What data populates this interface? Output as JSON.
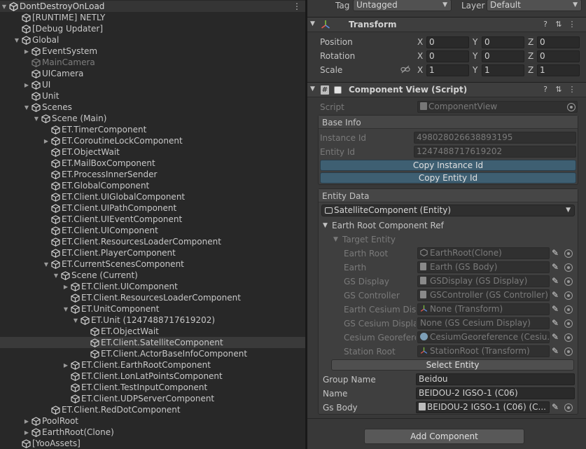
{
  "hierarchy": {
    "root": "DontDestroyOnLoad",
    "rows": [
      {
        "label": "[RUNTIME] NETLY",
        "depth": 1,
        "fold": "none",
        "style": "normal"
      },
      {
        "label": "[Debug Updater]",
        "depth": 1,
        "fold": "none",
        "style": "normal"
      },
      {
        "label": "Global",
        "depth": 1,
        "fold": "open",
        "style": "normal"
      },
      {
        "label": "EventSystem",
        "depth": 2,
        "fold": "closed",
        "style": "normal"
      },
      {
        "label": "MainCamera",
        "depth": 2,
        "fold": "none",
        "style": "dim"
      },
      {
        "label": "UICamera",
        "depth": 2,
        "fold": "none",
        "style": "normal"
      },
      {
        "label": "UI",
        "depth": 2,
        "fold": "closed",
        "style": "normal"
      },
      {
        "label": "Unit",
        "depth": 2,
        "fold": "none",
        "style": "normal"
      },
      {
        "label": "Scenes",
        "depth": 2,
        "fold": "open",
        "style": "normal"
      },
      {
        "label": "Scene (Main)",
        "depth": 3,
        "fold": "open",
        "style": "normal"
      },
      {
        "label": "ET.TimerComponent",
        "depth": 4,
        "fold": "none",
        "style": "normal"
      },
      {
        "label": "ET.CoroutineLockComponent",
        "depth": 4,
        "fold": "closed",
        "style": "normal"
      },
      {
        "label": "ET.ObjectWait",
        "depth": 4,
        "fold": "none",
        "style": "normal"
      },
      {
        "label": "ET.MailBoxComponent",
        "depth": 4,
        "fold": "none",
        "style": "normal"
      },
      {
        "label": "ET.ProcessInnerSender",
        "depth": 4,
        "fold": "none",
        "style": "normal"
      },
      {
        "label": "ET.GlobalComponent",
        "depth": 4,
        "fold": "none",
        "style": "normal"
      },
      {
        "label": "ET.Client.UIGlobalComponent",
        "depth": 4,
        "fold": "none",
        "style": "normal"
      },
      {
        "label": "ET.Client.UIPathComponent",
        "depth": 4,
        "fold": "none",
        "style": "normal"
      },
      {
        "label": "ET.Client.UIEventComponent",
        "depth": 4,
        "fold": "none",
        "style": "normal"
      },
      {
        "label": "ET.Client.UIComponent",
        "depth": 4,
        "fold": "none",
        "style": "normal"
      },
      {
        "label": "ET.Client.ResourcesLoaderComponent",
        "depth": 4,
        "fold": "none",
        "style": "normal"
      },
      {
        "label": "ET.Client.PlayerComponent",
        "depth": 4,
        "fold": "none",
        "style": "normal"
      },
      {
        "label": "ET.CurrentScenesComponent",
        "depth": 4,
        "fold": "open",
        "style": "normal"
      },
      {
        "label": "Scene (Current)",
        "depth": 5,
        "fold": "open",
        "style": "normal"
      },
      {
        "label": "ET.Client.UIComponent",
        "depth": 6,
        "fold": "closed",
        "style": "normal"
      },
      {
        "label": "ET.Client.ResourcesLoaderComponent",
        "depth": 6,
        "fold": "none",
        "style": "normal"
      },
      {
        "label": "ET.UnitComponent",
        "depth": 6,
        "fold": "open",
        "style": "normal"
      },
      {
        "label": "ET.Unit (1247488717619202)",
        "depth": 7,
        "fold": "open",
        "style": "normal"
      },
      {
        "label": "ET.ObjectWait",
        "depth": 8,
        "fold": "none",
        "style": "normal"
      },
      {
        "label": "ET.Client.SatelliteComponent",
        "depth": 8,
        "fold": "none",
        "style": "selected"
      },
      {
        "label": "ET.Client.ActorBaseInfoComponent",
        "depth": 8,
        "fold": "none",
        "style": "normal"
      },
      {
        "label": "ET.Client.EarthRootComponent",
        "depth": 6,
        "fold": "closed",
        "style": "normal"
      },
      {
        "label": "ET.Client.LonLatPointsComponent",
        "depth": 6,
        "fold": "none",
        "style": "normal"
      },
      {
        "label": "ET.Client.TestInputComponent",
        "depth": 6,
        "fold": "none",
        "style": "normal"
      },
      {
        "label": "ET.Client.UDPServerComponent",
        "depth": 6,
        "fold": "none",
        "style": "normal"
      },
      {
        "label": "ET.Client.RedDotComponent",
        "depth": 4,
        "fold": "none",
        "style": "normal"
      },
      {
        "label": "PoolRoot",
        "depth": 2,
        "fold": "closed",
        "style": "normal"
      },
      {
        "label": "EarthRoot(Clone)",
        "depth": 2,
        "fold": "closed",
        "style": "normal"
      },
      {
        "label": "[YooAssets]",
        "depth": 1,
        "fold": "none",
        "style": "normal"
      }
    ]
  },
  "inspector": {
    "tag_label": "Tag",
    "tag_value": "Untagged",
    "layer_label": "Layer",
    "layer_value": "Default",
    "transform": {
      "title": "Transform",
      "position_label": "Position",
      "rotation_label": "Rotation",
      "scale_label": "Scale",
      "axis_x": "X",
      "axis_y": "Y",
      "axis_z": "Z",
      "position": [
        "0",
        "0",
        "0"
      ],
      "rotation": [
        "0",
        "0",
        "0"
      ],
      "scale": [
        "1",
        "1",
        "1"
      ]
    },
    "component_view": {
      "title": "Component View (Script)",
      "script_label": "Script",
      "script_value": "ComponentView",
      "base_info_title": "Base Info",
      "instance_id_label": "Instance Id",
      "instance_id_value": "498028026638893195",
      "entity_id_label": "Entity Id",
      "entity_id_value": "1247488717619202",
      "copy_instance_btn": "Copy Instance Id",
      "copy_entity_btn": "Copy Entity Id",
      "entity_data_title": "Entity Data",
      "entity_dropdown": "SatelliteComponent (Entity)",
      "earth_root_ref": "Earth Root Component Ref",
      "target_entity": "Target Entity",
      "refs": [
        {
          "label": "Earth Root",
          "value": "EarthRoot(Clone)",
          "icon": "cube"
        },
        {
          "label": "Earth",
          "value": "Earth (GS Body)",
          "icon": "script"
        },
        {
          "label": "GS Display",
          "value": "GSDisplay (GS Display)",
          "icon": "script"
        },
        {
          "label": "GS Controller",
          "value": "GSController (GS Controller)",
          "icon": "script"
        },
        {
          "label": "Earth Cesium Disp",
          "value": "None (Transform)",
          "icon": "transform"
        },
        {
          "label": "GS Cesium Display",
          "value": "None (GS Cesium Display)",
          "icon": "none"
        },
        {
          "label": "Cesium Georefere",
          "value": "CesiumGeoreference (Cesiu...",
          "icon": "globe"
        },
        {
          "label": "Station Root",
          "value": "StationRoot (Transform)",
          "icon": "transform"
        }
      ],
      "select_entity_btn": "Select Entity",
      "group_name_label": "Group Name",
      "group_name_value": "Beidou",
      "name_label": "Name",
      "name_value": "BEIDOU-2 IGSO-1 (C06)",
      "gs_body_label": "Gs Body",
      "gs_body_value": "BEIDOU-2 IGSO-1 (C06)    (C..."
    },
    "add_component_btn": "Add Component"
  },
  "colors": {
    "hierarchy_bg": "#282828",
    "inspector_bg": "#383838",
    "selected_row": "#3a3a3a",
    "blue_button": "#3e5f72"
  }
}
